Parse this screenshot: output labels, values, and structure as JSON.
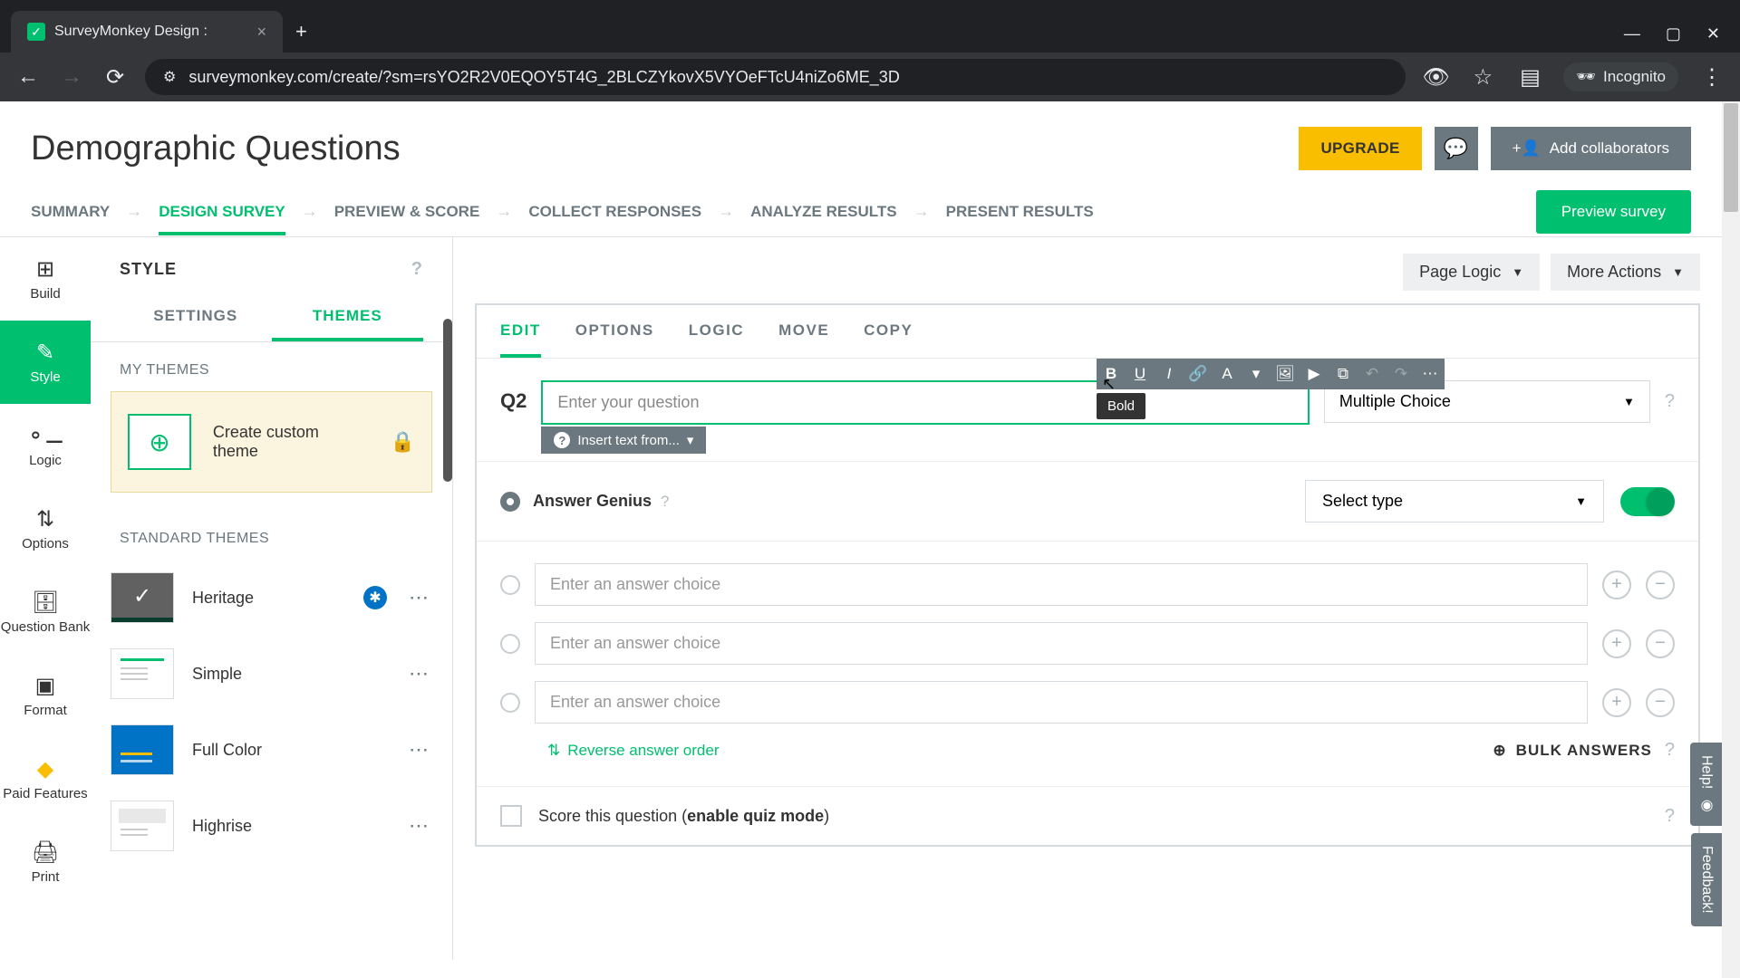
{
  "browser": {
    "tab_title": "SurveyMonkey Design :",
    "url": "surveymonkey.com/create/?sm=rsYO2R2V0EQOY5T4G_2BLCZYkovX5VYOeFTcU4niZo6ME_3D",
    "incognito_label": "Incognito"
  },
  "header": {
    "title": "Demographic Questions",
    "upgrade": "UPGRADE",
    "add_collaborators": "Add collaborators"
  },
  "tabs": {
    "summary": "SUMMARY",
    "design": "DESIGN SURVEY",
    "preview_score": "PREVIEW & SCORE",
    "collect": "COLLECT RESPONSES",
    "analyze": "ANALYZE RESULTS",
    "present": "PRESENT RESULTS",
    "preview_btn": "Preview survey"
  },
  "rail": {
    "build": "Build",
    "style": "Style",
    "logic": "Logic",
    "options": "Options",
    "question_bank": "Question Bank",
    "format": "Format",
    "paid": "Paid Features",
    "print": "Print"
  },
  "panel": {
    "title": "STYLE",
    "settings": "SETTINGS",
    "themes": "THEMES",
    "my_themes": "MY THEMES",
    "create_custom": "Create custom theme",
    "standard_themes": "STANDARD THEMES",
    "theme_heritage": "Heritage",
    "theme_simple": "Simple",
    "theme_fullcolor": "Full Color",
    "theme_highrise": "Highrise"
  },
  "canvas": {
    "page_logic": "Page Logic",
    "more_actions": "More Actions"
  },
  "question": {
    "tabs": {
      "edit": "EDIT",
      "options": "OPTIONS",
      "logic": "LOGIC",
      "move": "MOVE",
      "copy": "COPY"
    },
    "q_label": "Q2",
    "placeholder": "Enter your question",
    "insert_text": "Insert text from...",
    "type": "Multiple Choice",
    "tooltip_bold": "Bold",
    "genius_label": "Answer Genius",
    "genius_select": "Select type",
    "answer_placeholder": "Enter an answer choice",
    "reverse": "Reverse answer order",
    "bulk": "BULK ANSWERS",
    "score_pre": "Score this question (",
    "score_bold": "enable quiz mode",
    "score_post": ")"
  },
  "side_tabs": {
    "help": "Help!",
    "feedback": "Feedback!"
  }
}
